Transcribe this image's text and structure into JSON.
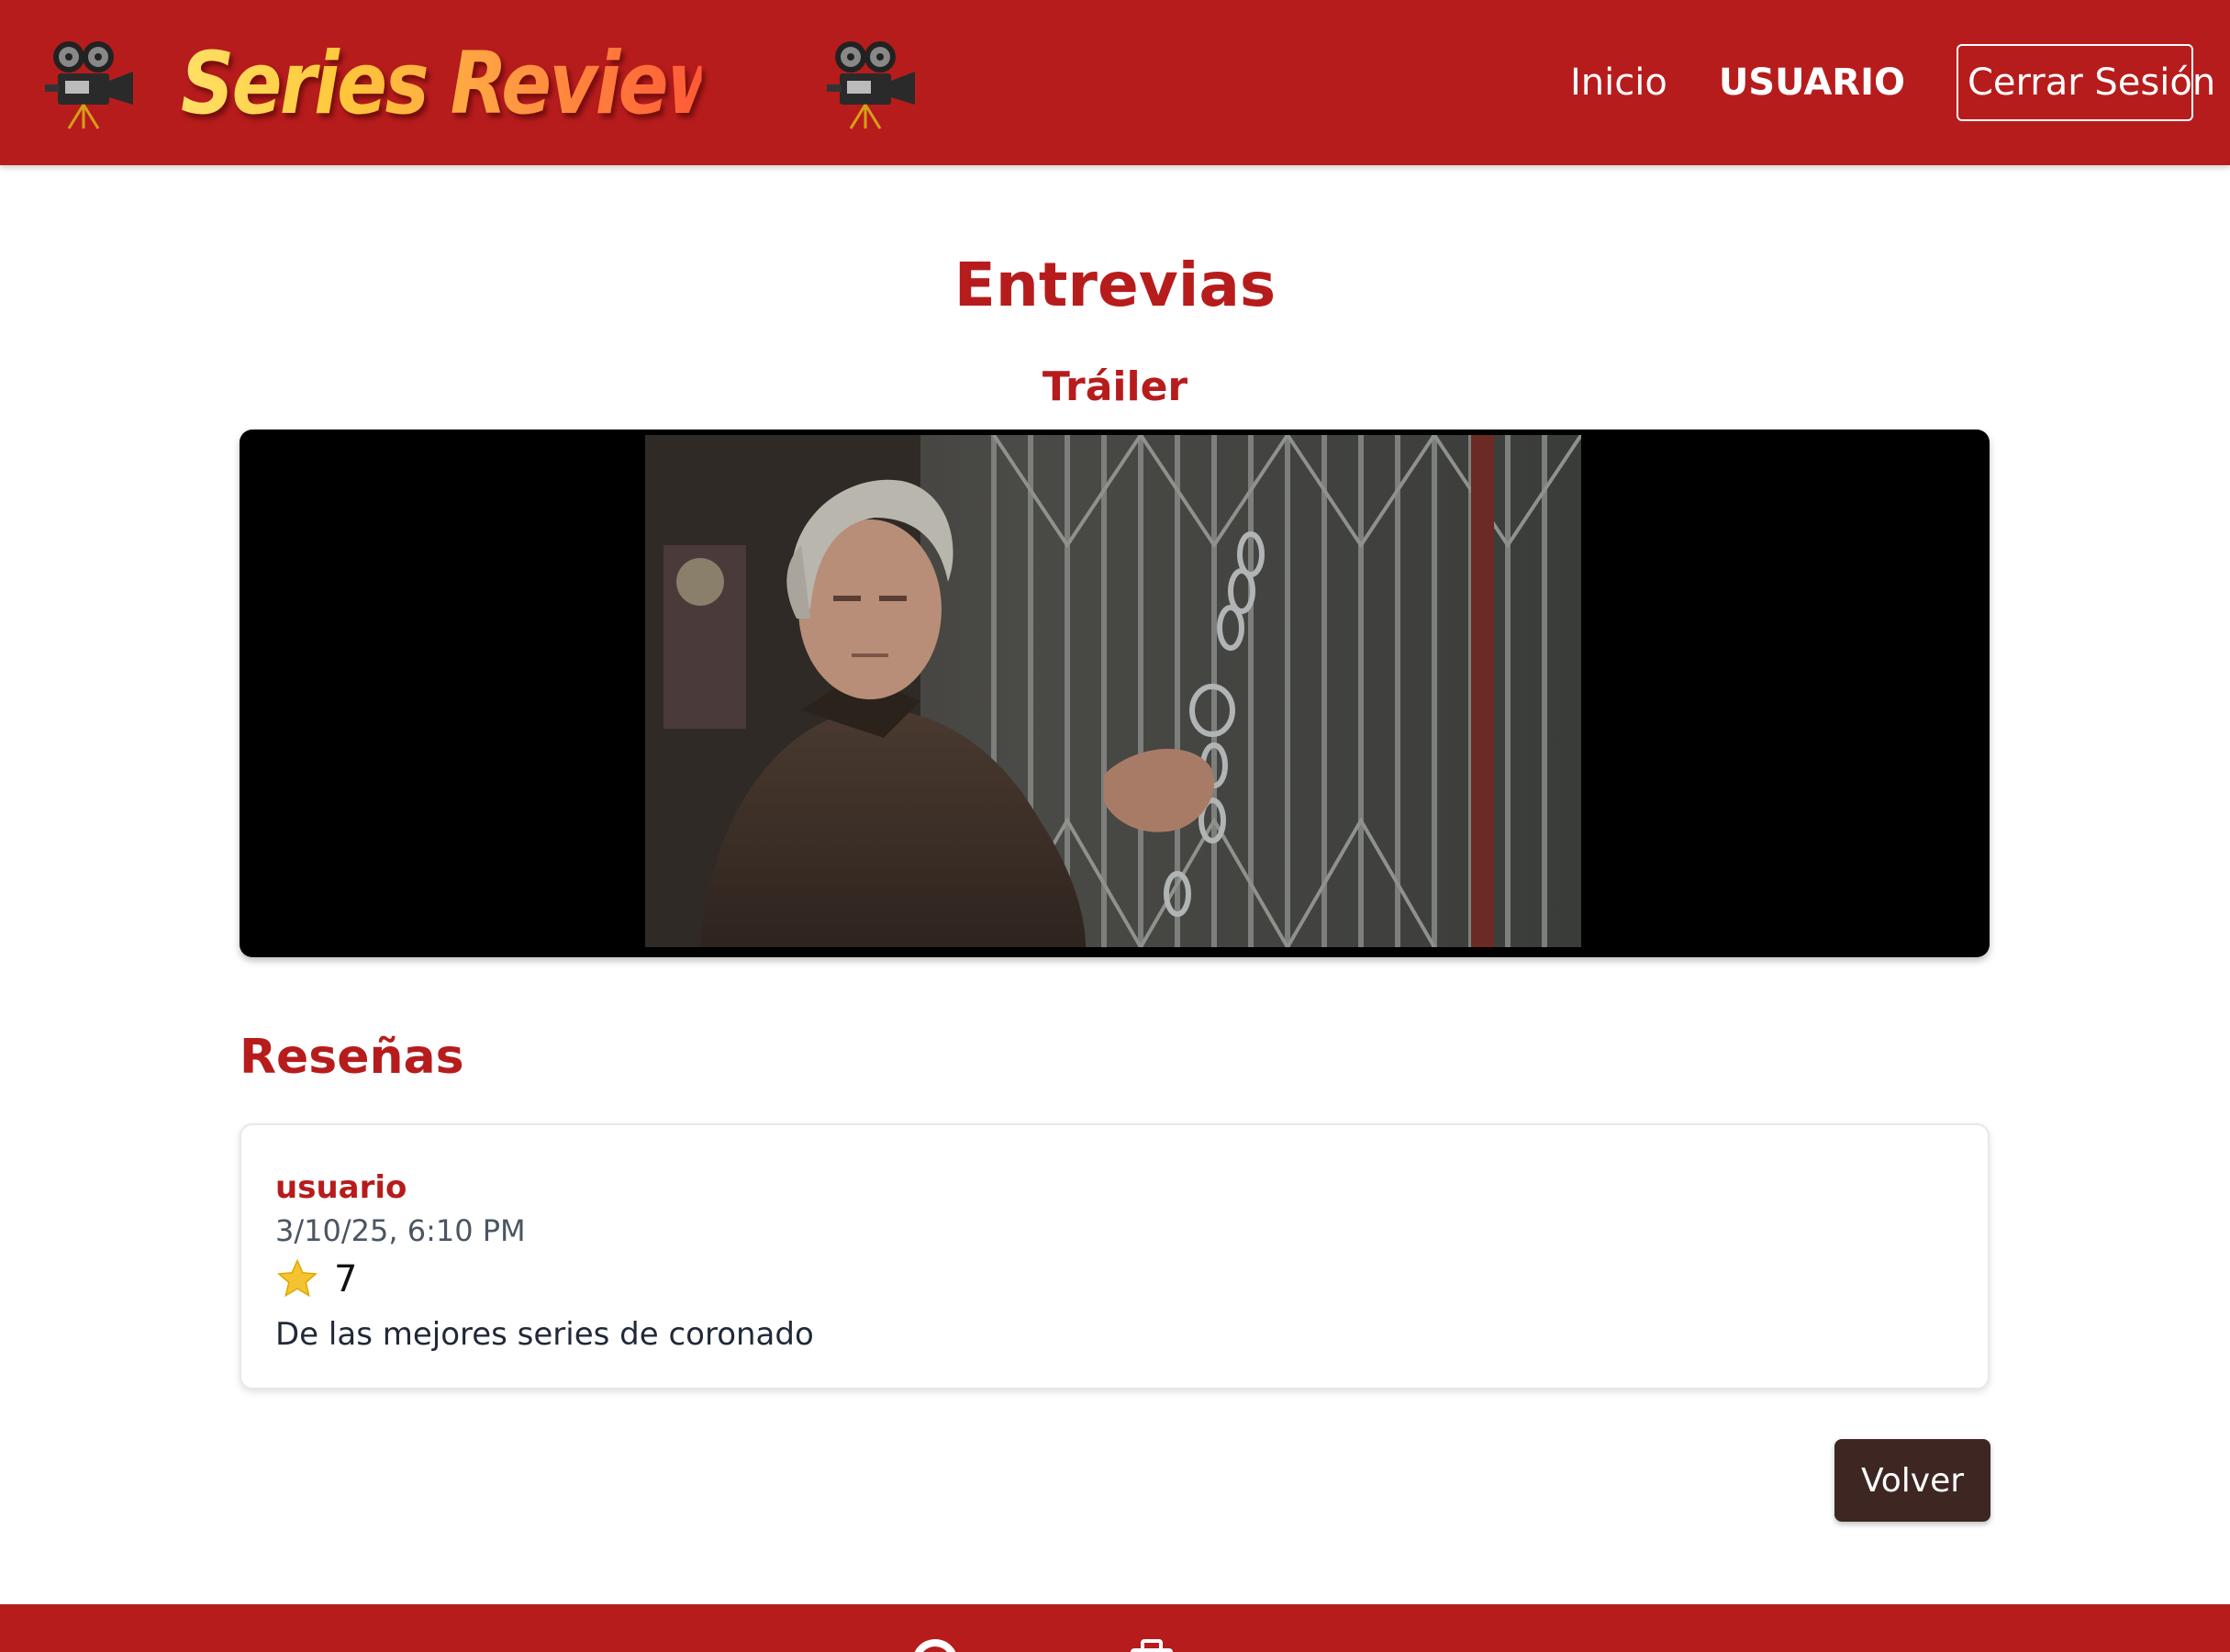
{
  "header": {
    "logo_text": "Series Reviews",
    "nav": {
      "home": "Inicio",
      "user": "USUARIO",
      "logout": "Cerrar Sesión"
    }
  },
  "series": {
    "title": "Entrevias",
    "trailer_label": "Tráiler"
  },
  "reviews": {
    "heading": "Reseñas",
    "items": [
      {
        "user": "usuario",
        "date": "3/10/25, 6:10 PM",
        "rating": "7",
        "text": "De las mejores series de coronado"
      }
    ]
  },
  "actions": {
    "back_label": "Volver"
  },
  "colors": {
    "primary": "#b71c1c",
    "back_button": "#3e2723",
    "star": "#f4c430"
  },
  "icons": {
    "logo_left": "film-camera-icon",
    "logo_right": "film-camera-icon",
    "rating": "star-icon",
    "footer": [
      "github-icon",
      "briefcase-icon"
    ]
  }
}
